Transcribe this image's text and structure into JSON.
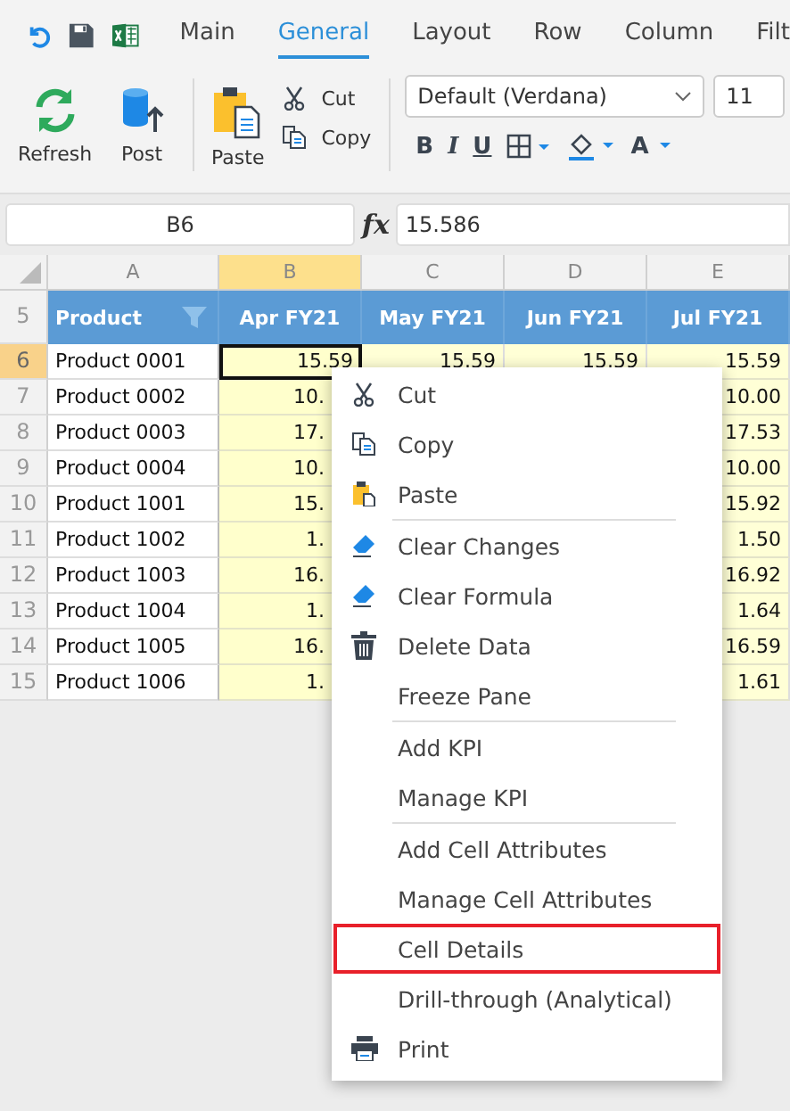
{
  "quick_access": [
    {
      "kind": "undo"
    },
    {
      "kind": "save"
    },
    {
      "kind": "excel"
    }
  ],
  "tabs": [
    {
      "label": "Main",
      "selected": false
    },
    {
      "label": "General",
      "selected": true
    },
    {
      "label": "Layout",
      "selected": false
    },
    {
      "label": "Row",
      "selected": false
    },
    {
      "label": "Column",
      "selected": false
    },
    {
      "label": "Filt",
      "selected": false
    }
  ],
  "ribbon": {
    "large_buttons": [
      {
        "label": "Refresh",
        "kind": "refresh"
      },
      {
        "label": "Post",
        "kind": "post"
      }
    ],
    "paste": {
      "label": "Paste"
    },
    "small_buttons": [
      {
        "label": "Cut",
        "kind": "cut"
      },
      {
        "label": "Copy",
        "kind": "copy"
      }
    ],
    "font_select": {
      "value": "Default (Verdana)"
    },
    "size_select": {
      "value": "11"
    },
    "format_buttons": [
      {
        "kind": "bold",
        "label": "B"
      },
      {
        "kind": "italic",
        "label": "I"
      },
      {
        "kind": "underline",
        "label": "U"
      },
      {
        "kind": "borders"
      },
      {
        "kind": "fill"
      },
      {
        "kind": "font_color",
        "label": "A"
      }
    ]
  },
  "formula_bar": {
    "cell_ref": "B6",
    "fx": "fx",
    "value": "15.586"
  },
  "sheet": {
    "column_letters": [
      {
        "label": "A",
        "selected": false
      },
      {
        "label": "B",
        "selected": true
      },
      {
        "label": "C",
        "selected": false
      },
      {
        "label": "D",
        "selected": false
      },
      {
        "label": "E",
        "selected": false
      }
    ],
    "header_row": {
      "number": "5",
      "cells": [
        "Product",
        "Apr FY21",
        "May FY21",
        "Jun FY21",
        "Jul FY21"
      ]
    },
    "rows": [
      {
        "number": "6",
        "selected": true,
        "cells": [
          "Product 0001",
          "15.59",
          "15.59",
          "15.59",
          "15.59"
        ]
      },
      {
        "number": "7",
        "selected": false,
        "cells": [
          "Product 0002",
          "10.",
          "",
          "",
          "10.00"
        ]
      },
      {
        "number": "8",
        "selected": false,
        "cells": [
          "Product 0003",
          "17.",
          "",
          "",
          "17.53"
        ]
      },
      {
        "number": "9",
        "selected": false,
        "cells": [
          "Product 0004",
          "10.",
          "",
          "",
          "10.00"
        ]
      },
      {
        "number": "10",
        "selected": false,
        "cells": [
          "Product 1001",
          "15.",
          "",
          "",
          "15.92"
        ]
      },
      {
        "number": "11",
        "selected": false,
        "cells": [
          "Product 1002",
          "1.",
          "",
          "",
          "1.50"
        ]
      },
      {
        "number": "12",
        "selected": false,
        "cells": [
          "Product 1003",
          "16.",
          "",
          "",
          "16.92"
        ]
      },
      {
        "number": "13",
        "selected": false,
        "cells": [
          "Product 1004",
          "1.",
          "",
          "",
          "1.64"
        ]
      },
      {
        "number": "14",
        "selected": false,
        "cells": [
          "Product 1005",
          "16.",
          "",
          "",
          "16.59"
        ]
      },
      {
        "number": "15",
        "selected": false,
        "cells": [
          "Product 1006",
          "1.",
          "",
          "",
          "1.61"
        ]
      }
    ]
  },
  "context_menu": {
    "groups": [
      [
        {
          "label": "Cut",
          "kind": "cut",
          "highlighted": false
        },
        {
          "label": "Copy",
          "kind": "copy",
          "highlighted": false
        },
        {
          "label": "Paste",
          "kind": "paste",
          "highlighted": false
        }
      ],
      [
        {
          "label": "Clear Changes",
          "kind": "clear",
          "highlighted": false
        },
        {
          "label": "Clear Formula",
          "kind": "clear",
          "highlighted": false
        },
        {
          "label": "Delete Data",
          "kind": "delete",
          "highlighted": false
        },
        {
          "label": "Freeze Pane",
          "highlighted": false
        }
      ],
      [
        {
          "label": "Add KPI",
          "highlighted": false
        },
        {
          "label": "Manage KPI",
          "highlighted": false
        }
      ],
      [
        {
          "label": "Add Cell Attributes",
          "highlighted": false
        },
        {
          "label": "Manage Cell Attributes",
          "highlighted": false
        },
        {
          "label": "Cell Details",
          "highlighted": true
        },
        {
          "label": "Drill-through (Analytical)",
          "highlighted": false
        },
        {
          "label": "Print",
          "kind": "print",
          "highlighted": false
        }
      ]
    ]
  }
}
